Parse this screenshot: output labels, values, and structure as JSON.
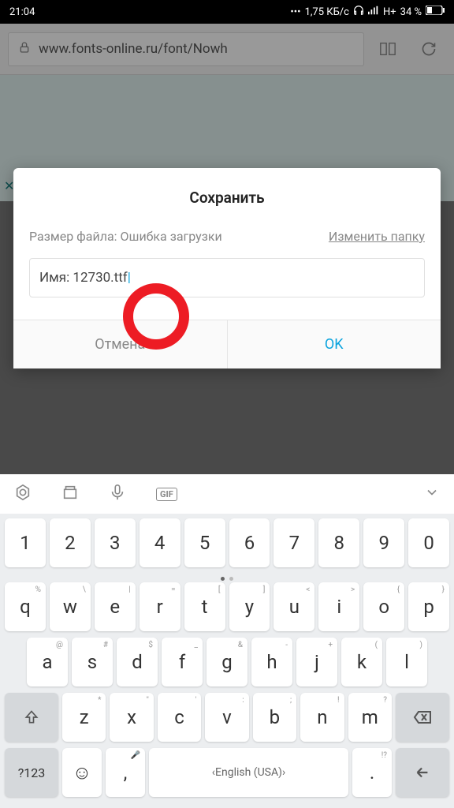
{
  "status": {
    "time": "21:04",
    "speed": "1,75 КБ/с",
    "network": "H+",
    "battery": "34 %"
  },
  "browser": {
    "url": "www.fonts-online.ru/font/Nowh"
  },
  "dialog": {
    "title": "Сохранить",
    "size_label": "Размер файла:",
    "size_error": "Ошибка загрузки",
    "change_folder": "Изменить папку",
    "name_label": "Имя: ",
    "filename": "12730.ttf",
    "cancel": "Отмена",
    "ok": "OK"
  },
  "keyboard": {
    "row1": [
      "1",
      "2",
      "3",
      "4",
      "5",
      "6",
      "7",
      "8",
      "9",
      "0"
    ],
    "row2": [
      {
        "k": "q",
        "s": "%"
      },
      {
        "k": "w",
        "s": "\\"
      },
      {
        "k": "e",
        "s": "|"
      },
      {
        "k": "r",
        "s": "="
      },
      {
        "k": "t",
        "s": "["
      },
      {
        "k": "y",
        "s": "]"
      },
      {
        "k": "u",
        "s": "<"
      },
      {
        "k": "i",
        "s": ">"
      },
      {
        "k": "o",
        "s": "{"
      },
      {
        "k": "p",
        "s": "}"
      }
    ],
    "row3": [
      {
        "k": "a",
        "s": "@"
      },
      {
        "k": "s",
        "s": "#"
      },
      {
        "k": "d",
        "s": "$"
      },
      {
        "k": "f",
        "s": "_"
      },
      {
        "k": "g",
        "s": "&"
      },
      {
        "k": "h",
        "s": "-"
      },
      {
        "k": "j",
        "s": "+"
      },
      {
        "k": "k",
        "s": "("
      },
      {
        "k": "l",
        "s": ")"
      }
    ],
    "row4": [
      {
        "k": "z",
        "s": "*"
      },
      {
        "k": "x",
        "s": "\""
      },
      {
        "k": "c",
        "s": "'"
      },
      {
        "k": "v",
        "s": ":"
      },
      {
        "k": "b",
        "s": ";"
      },
      {
        "k": "n",
        "s": "!"
      },
      {
        "k": "m",
        "s": "?"
      }
    ],
    "sym": "?123",
    "space": "English (USA)",
    "period_sup": "!?"
  }
}
